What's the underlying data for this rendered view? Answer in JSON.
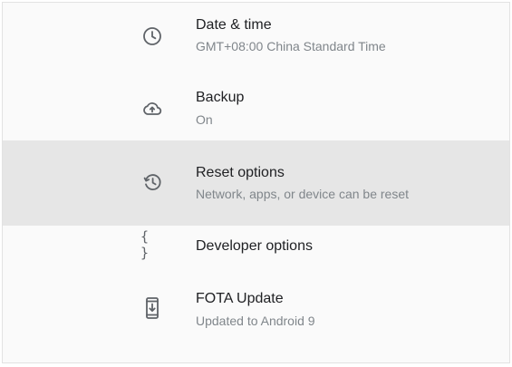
{
  "settings": {
    "items": [
      {
        "title": "Date & time",
        "subtitle": "GMT+08:00 China Standard Time",
        "icon": "clock-icon"
      },
      {
        "title": "Backup",
        "subtitle": "On",
        "icon": "cloud-upload-icon"
      },
      {
        "title": "Reset options",
        "subtitle": "Network, apps, or device can be reset",
        "icon": "history-icon"
      },
      {
        "title": "Developer options",
        "icon": "braces-icon"
      },
      {
        "title": "FOTA Update",
        "subtitle": "Updated to Android 9",
        "icon": "system-update-icon"
      }
    ],
    "braces_glyph": "{ }"
  },
  "colors": {
    "background": "#fafafa",
    "highlight": "#e6e6e6",
    "title_text": "#202124",
    "subtitle_text": "#80868b",
    "icon": "#5f6368"
  }
}
